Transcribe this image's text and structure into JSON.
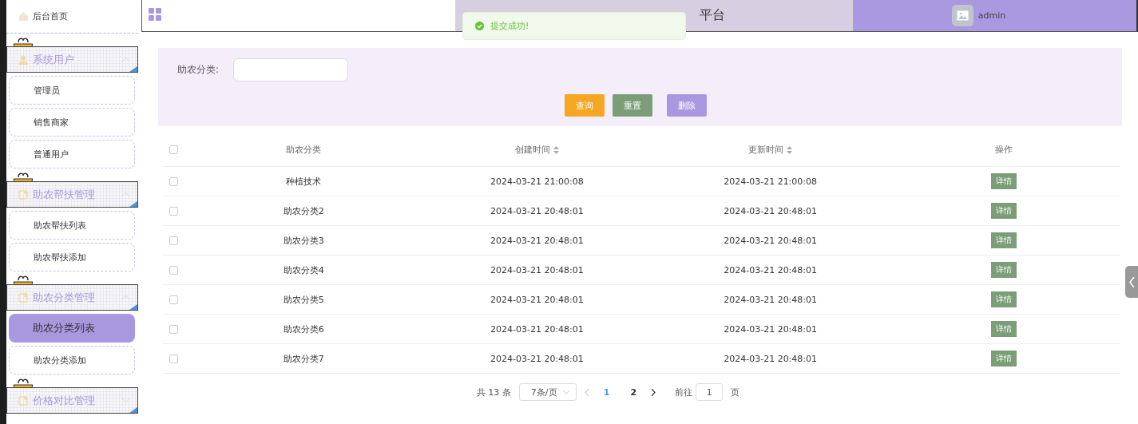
{
  "sidebar": {
    "home": {
      "label": "后台首页"
    },
    "groups": [
      {
        "title": "系统用户",
        "expanded": true,
        "items": [
          {
            "label": "管理员",
            "selected": false
          },
          {
            "label": "销售商家",
            "selected": false
          },
          {
            "label": "普通用户",
            "selected": false
          }
        ]
      },
      {
        "title": "助农帮扶管理",
        "expanded": true,
        "items": [
          {
            "label": "助农帮扶列表",
            "selected": false
          },
          {
            "label": "助农帮扶添加",
            "selected": false
          }
        ]
      },
      {
        "title": "助农分类管理",
        "expanded": true,
        "items": [
          {
            "label": "助农分类列表",
            "selected": true
          },
          {
            "label": "助农分类添加",
            "selected": false
          }
        ]
      },
      {
        "title": "价格对比管理",
        "expanded": false
      }
    ]
  },
  "header": {
    "title": "平台",
    "user": "admin"
  },
  "toast": {
    "message": "提交成功!"
  },
  "filter": {
    "label": "助农分类:",
    "buttons": [
      {
        "label": "查询",
        "kind": "search"
      },
      {
        "label": "重置",
        "kind": "reset"
      },
      {
        "label": "删除",
        "kind": "delete"
      }
    ]
  },
  "table": {
    "all_checked": false,
    "columns": [
      {
        "label": "助农分类",
        "sortable": false
      },
      {
        "label": "创建时间",
        "sortable": true
      },
      {
        "label": "更新时间",
        "sortable": true
      },
      {
        "label": "操作",
        "sortable": false
      }
    ],
    "rows": [
      {
        "checked": false,
        "name": "种植技术",
        "created": "2024-03-21 21:00:08",
        "updated": "2024-03-21 21:00:08",
        "action": "详情"
      },
      {
        "checked": false,
        "name": "助农分类2",
        "created": "2024-03-21 20:48:01",
        "updated": "2024-03-21 20:48:01",
        "action": "详情"
      },
      {
        "checked": false,
        "name": "助农分类3",
        "created": "2024-03-21 20:48:01",
        "updated": "2024-03-21 20:48:01",
        "action": "详情"
      },
      {
        "checked": false,
        "name": "助农分类4",
        "created": "2024-03-21 20:48:01",
        "updated": "2024-03-21 20:48:01",
        "action": "详情"
      },
      {
        "checked": false,
        "name": "助农分类5",
        "created": "2024-03-21 20:48:01",
        "updated": "2024-03-21 20:48:01",
        "action": "详情"
      },
      {
        "checked": false,
        "name": "助农分类6",
        "created": "2024-03-21 20:48:01",
        "updated": "2024-03-21 20:48:01",
        "action": "详情"
      },
      {
        "checked": false,
        "name": "助农分类7",
        "created": "2024-03-21 20:48:01",
        "updated": "2024-03-21 20:48:01",
        "action": "详情"
      }
    ]
  },
  "pagination": {
    "total": "共 13 条",
    "page_size": "7条/页",
    "pages": [
      {
        "label": "1",
        "selected": true
      },
      {
        "label": "2",
        "selected": false
      }
    ],
    "goto_label": "前往",
    "goto_value": "1",
    "goto_suffix": "页"
  }
}
